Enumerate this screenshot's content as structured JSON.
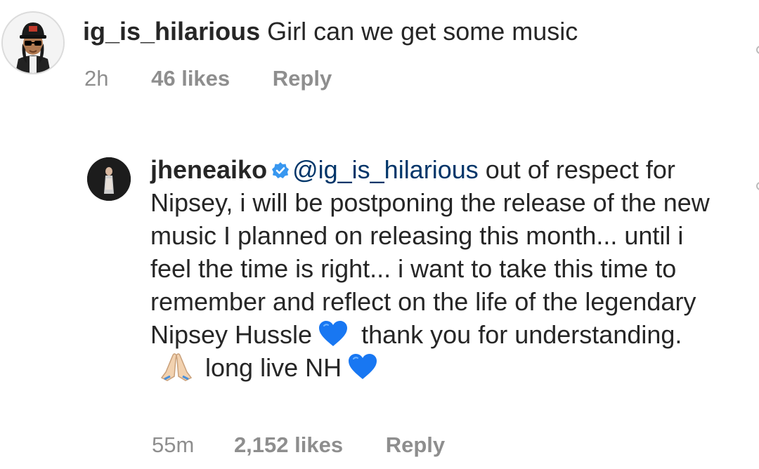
{
  "comment": {
    "username": "ig_is_hilarious",
    "text": "Girl can we get some music",
    "time": "2h",
    "likes": "46 likes",
    "reply_label": "Reply"
  },
  "reply": {
    "username": "jheneaiko",
    "mention": "@ig_is_hilarious",
    "text_part1": " out of respect for Nipsey, i will be postponing the release of the new music I planned on releasing this month... until i feel the time is right... i want to take this time to remember and reflect on the life of the legendary Nipsey Hussle",
    "text_part2": " thank you for understanding.",
    "text_part3": " long live NH",
    "time": "55m",
    "likes": "2,152 likes",
    "reply_label": "Reply"
  },
  "icons": {
    "verified": "verified-badge-icon",
    "heart": "blue-heart-emoji",
    "hands": "folded-hands-emoji",
    "like": "heart-outline-icon"
  },
  "colors": {
    "username": "#262626",
    "meta": "#8e8e8e",
    "mention": "#003569",
    "verified": "#3897f0",
    "heart": "#1877f2"
  }
}
